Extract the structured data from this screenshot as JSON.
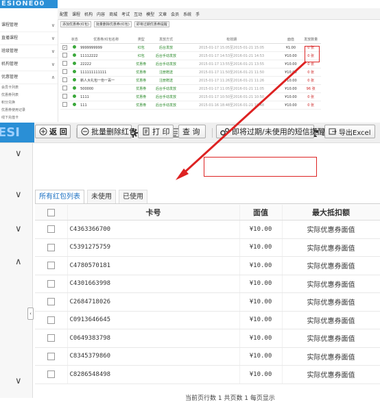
{
  "top": {
    "logo": "ESIONE00",
    "nav": [
      "配置",
      "课程",
      "机构",
      "内容",
      "商城",
      "考试",
      "互动",
      "模型",
      "文章",
      "会员",
      "系统",
      "手"
    ],
    "sidebar": [
      {
        "label": "课程管理",
        "chev": "∨"
      },
      {
        "label": "直播课程",
        "chev": "∨"
      },
      {
        "label": "班级管理",
        "chev": "∨"
      },
      {
        "label": "机构管理",
        "chev": "∨"
      },
      {
        "label": "优惠管理",
        "chev": "∧"
      }
    ],
    "sidebar_sub": [
      "会员卡列表",
      "优惠券列表",
      "积分兑换",
      "优惠券使用记录",
      "线下充值卡"
    ],
    "toolbar": [
      "添加优惠券(红包)",
      "批量删除优惠券(红包)",
      "即将过期优惠券提醒"
    ],
    "headers": [
      "状态",
      "优惠券/红包名称",
      "类型",
      "发放方式",
      "有效期",
      "面值",
      "发放数量"
    ],
    "rows": [
      {
        "checked": true,
        "name": "9999999999",
        "type": "红包",
        "method": "后台发放",
        "date": "2015-01-17 15:05至2015-01-21 15:05",
        "value": "¥1.00",
        "count": "0 张",
        "hl": true
      },
      {
        "checked": false,
        "name": "11112222",
        "type": "红包",
        "method": "后台手动发放",
        "date": "2015-01-17 14:53至2016-01-21 14:53",
        "value": "¥10.00",
        "count": "0 张",
        "hl": true
      },
      {
        "checked": false,
        "name": "22222",
        "type": "优惠券",
        "method": "后台手动发放",
        "date": "2015-01-17 13:55至2016-01-21 13:55",
        "value": "¥10.00",
        "count": "0 张",
        "hl": false
      },
      {
        "checked": false,
        "name": "111111111111",
        "type": "优惠券",
        "method": "注册赠送",
        "date": "2015-01-17 11:50至2016-01-21 11:50",
        "value": "¥10.00",
        "count": "0 张",
        "hl": false
      },
      {
        "checked": false,
        "name": "新人大礼包一份一百一",
        "type": "优惠券",
        "method": "注册赠送",
        "date": "2015-01-17 11:26至2016-01-21 11:26",
        "value": "¥10.00",
        "count": "0 张",
        "hl": false
      },
      {
        "checked": false,
        "name": "500000",
        "type": "优惠券",
        "method": "后台手动发放",
        "date": "2015-01-17 11:05至2016-01-21 11:05",
        "value": "¥10.00",
        "count": "96 张",
        "hl": false
      },
      {
        "checked": false,
        "name": "1111",
        "type": "优惠券",
        "method": "后台手动发放",
        "date": "2015-01-17 10:50至2016-01-21 10:50",
        "value": "¥10.00",
        "count": "0 张",
        "hl": false
      },
      {
        "checked": false,
        "name": "111",
        "type": "优惠券",
        "method": "后台手动发放",
        "date": "2015-01-16 18:48至2016-01-21 18:48",
        "value": "¥10.00",
        "count": "0 张",
        "hl": false
      }
    ]
  },
  "big": {
    "nav": [
      {
        "label": "配置",
        "icon": "gear-icon"
      },
      {
        "label": "课程",
        "icon": "user-icon"
      },
      {
        "label": "机构",
        "icon": "gear-icon"
      },
      {
        "label": "内容",
        "icon": "document-icon"
      },
      {
        "label": "商城",
        "icon": "shop-icon"
      },
      {
        "label": "考试",
        "icon": "document-icon"
      },
      {
        "label": "互动",
        "icon": "user-icon"
      },
      {
        "label": "模型",
        "icon": "grid-icon"
      }
    ],
    "buttons": {
      "back": "返 回",
      "batch_delete": "批量删除红包",
      "print": "打 印",
      "search": "查 询",
      "remind": "即将过期/未使用的短信提醒",
      "export": "导出Excel"
    },
    "tabs": [
      "所有红包列表",
      "未使用",
      "已使用"
    ],
    "columns": {
      "card": "卡号",
      "value": "面值",
      "deduct": "最大抵扣额"
    },
    "rows": [
      {
        "card": "C4363366700",
        "value": "¥10.00",
        "deduct": "实际优惠券面值"
      },
      {
        "card": "C5391275759",
        "value": "¥10.00",
        "deduct": "实际优惠券面值"
      },
      {
        "card": "C4780570181",
        "value": "¥10.00",
        "deduct": "实际优惠券面值"
      },
      {
        "card": "C4301663998",
        "value": "¥10.00",
        "deduct": "实际优惠券面值"
      },
      {
        "card": "C2684718026",
        "value": "¥10.00",
        "deduct": "实际优惠券面值"
      },
      {
        "card": "C0913646645",
        "value": "¥10.00",
        "deduct": "实际优惠券面值"
      },
      {
        "card": "C0649383798",
        "value": "¥10.00",
        "deduct": "实际优惠券面值"
      },
      {
        "card": "C8345379860",
        "value": "¥10.00",
        "deduct": "实际优惠券面值"
      },
      {
        "card": "C8286548498",
        "value": "¥10.00",
        "deduct": "实际优惠券面值"
      }
    ],
    "pager": "当前页行数  1   共页数  1  每页显示"
  },
  "colors": {
    "accent": "#1a6fc2",
    "highlight": "#d22222",
    "brand": "#2a8fd6"
  }
}
